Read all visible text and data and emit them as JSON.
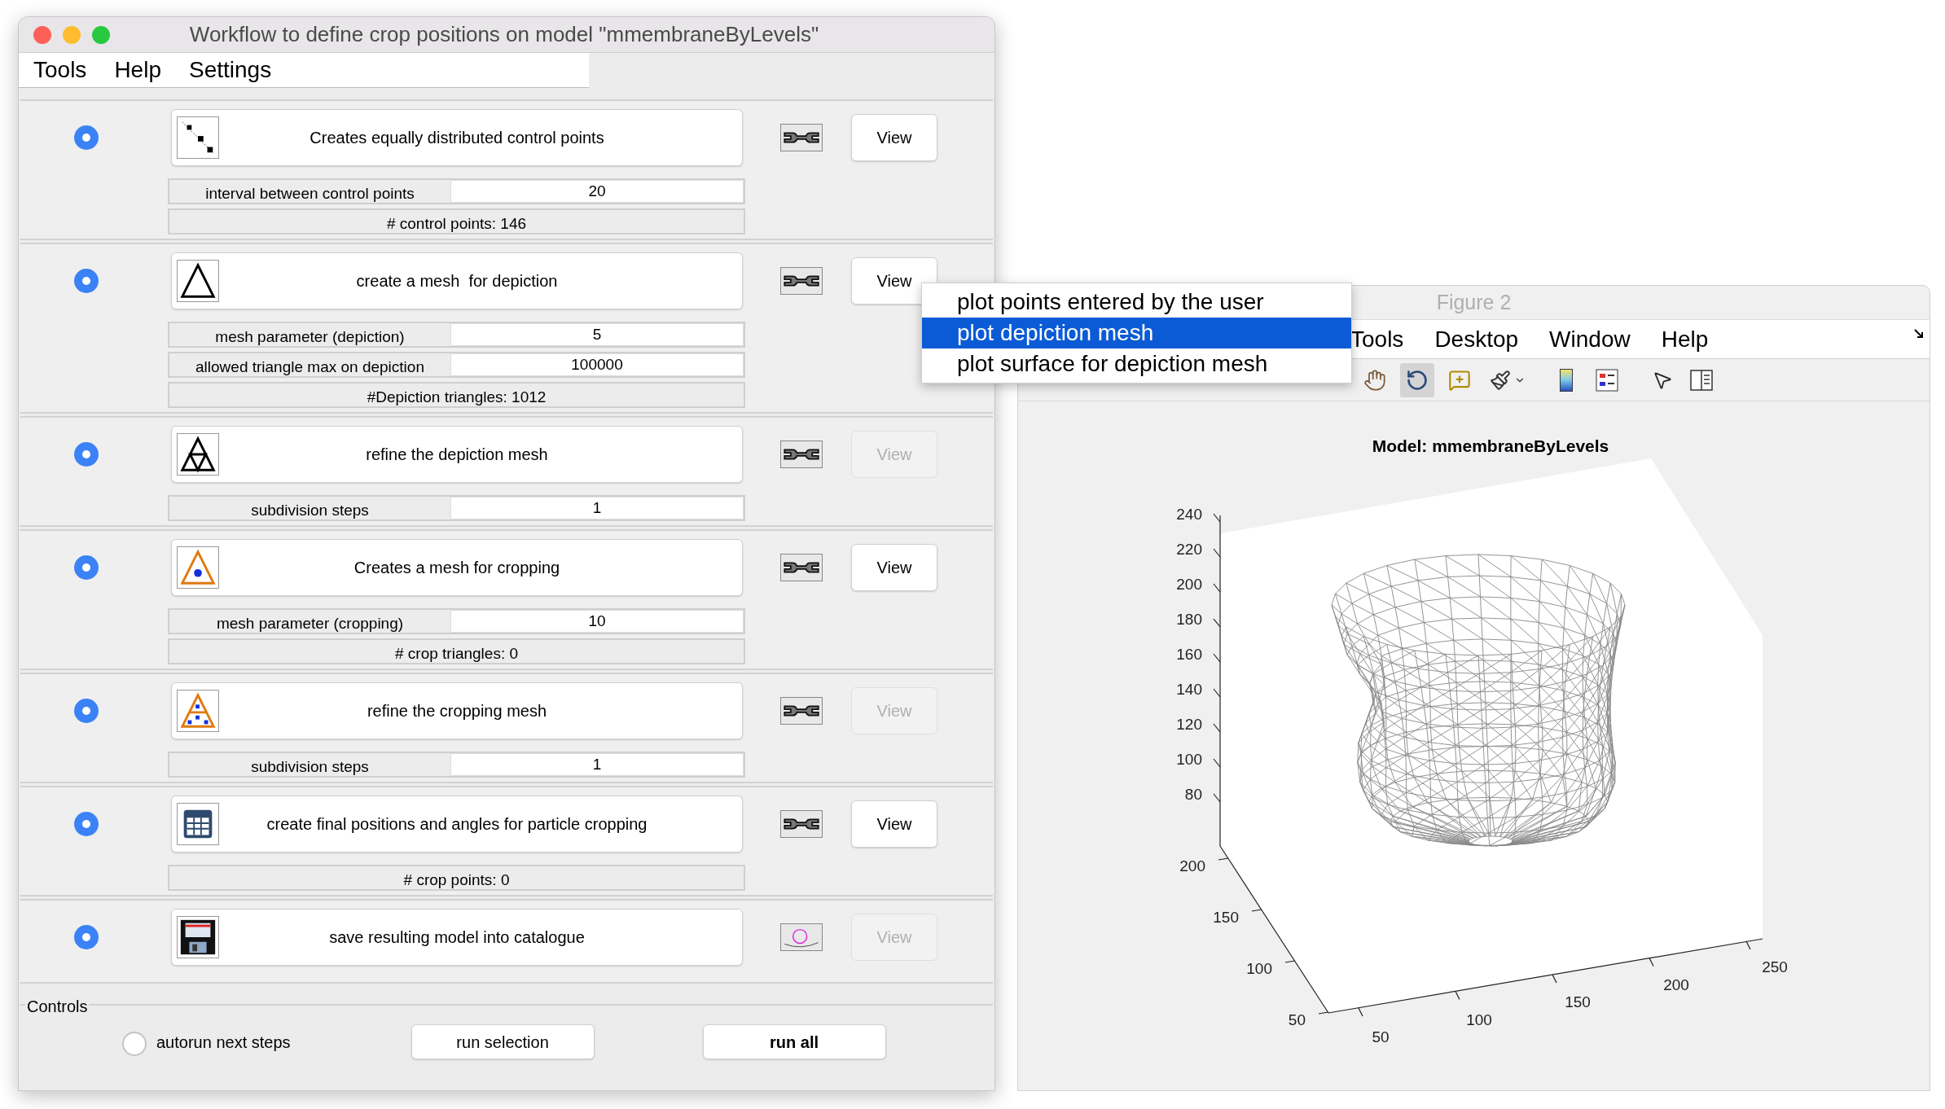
{
  "window": {
    "title": "Workflow to define crop positions on model \"mmembraneByLevels\""
  },
  "menu": [
    "Tools",
    "Help",
    "Settings"
  ],
  "steps": [
    {
      "selected": true,
      "label": "Creates equally distributed control points",
      "view": {
        "label": "View",
        "disabled": false
      },
      "fields": [
        {
          "label": "interval between control points",
          "value": "20"
        }
      ],
      "info": [
        "# control points: 146"
      ]
    },
    {
      "selected": true,
      "label": "create a mesh  for depiction",
      "view": {
        "label": "View",
        "disabled": false
      },
      "fields": [
        {
          "label": "mesh parameter (depiction)",
          "value": "5"
        },
        {
          "label": "allowed triangle max on depiction",
          "value": "100000"
        }
      ],
      "info": [
        "#Depiction triangles: 1012"
      ]
    },
    {
      "selected": true,
      "label": "refine the depiction mesh",
      "view": {
        "label": "View",
        "disabled": true
      },
      "fields": [
        {
          "label": "subdivision steps",
          "value": "1"
        }
      ]
    },
    {
      "selected": true,
      "label": "Creates a mesh for cropping",
      "view": {
        "label": "View",
        "disabled": false
      },
      "fields": [
        {
          "label": "mesh parameter (cropping)",
          "value": "10"
        }
      ],
      "info": [
        "# crop triangles: 0"
      ]
    },
    {
      "selected": true,
      "label": "refine the cropping mesh",
      "view": {
        "label": "View",
        "disabled": true
      },
      "fields": [
        {
          "label": "subdivision steps",
          "value": "1"
        }
      ]
    },
    {
      "selected": true,
      "label": "create final positions and angles for particle cropping",
      "view": {
        "label": "View",
        "disabled": false
      },
      "info": [
        "# crop points: 0"
      ]
    },
    {
      "selected": true,
      "label": "save resulting model into catalogue",
      "view": {
        "label": "View",
        "disabled": true
      }
    }
  ],
  "controls": {
    "title": "Controls",
    "autorun": {
      "label": "autorun next steps",
      "checked": false
    },
    "buttons": [
      {
        "label": "run selection",
        "default": false
      },
      {
        "label": "run all",
        "default": true
      }
    ]
  },
  "popup": {
    "items": [
      {
        "label": "plot points entered by the user",
        "selected": false
      },
      {
        "label": "plot depiction mesh",
        "selected": true
      },
      {
        "label": "plot surface for depiction mesh",
        "selected": false
      }
    ]
  },
  "figure": {
    "title": "Figure 2",
    "menu": [
      "Tools",
      "Desktop",
      "Window",
      "Help"
    ],
    "toolbar": [
      {
        "kind": "hand",
        "selected": false
      },
      {
        "kind": "rotate",
        "selected": true
      },
      {
        "kind": "datacursor",
        "selected": false
      },
      {
        "kind": "brush",
        "selected": false
      },
      {
        "kind": "colorbar",
        "selected": false
      },
      {
        "kind": "legend",
        "selected": false
      },
      {
        "kind": "pointer",
        "selected": false
      },
      {
        "kind": "inspector",
        "selected": false
      }
    ],
    "plot": {
      "title": "Model: mmembraneByLevels",
      "z_ticks": [
        "240",
        "220",
        "200",
        "180",
        "160",
        "140",
        "120",
        "100",
        "80"
      ],
      "y_ticks": [
        "200",
        "150",
        "100",
        "50"
      ],
      "x_ticks": [
        "50",
        "100",
        "150",
        "200",
        "250"
      ]
    }
  }
}
